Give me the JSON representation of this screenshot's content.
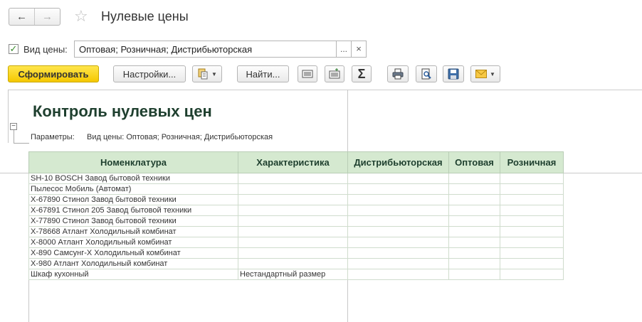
{
  "window": {
    "title": "Нулевые цены",
    "back_icon": "←",
    "forward_icon": "→",
    "star_icon": "☆"
  },
  "filter": {
    "checked_mark": "✓",
    "label": "Вид цены:",
    "value": "Оптовая; Розничная; Дистрибьюторская",
    "dots": "...",
    "clear": "×"
  },
  "toolbar": {
    "generate": "Сформировать",
    "settings": "Настройки...",
    "find": "Найти...",
    "sum_icon": "Σ",
    "caret": "▼"
  },
  "report": {
    "title": "Контроль нулевых цен",
    "params_label": "Параметры:",
    "params_value": "Вид цены: Оптовая; Розничная; Дистрибьюторская",
    "collapse": "−",
    "columns": [
      "Номенклатура",
      "Характеристика",
      "Дистрибьюторская",
      "Оптовая",
      "Розничная"
    ],
    "rows": [
      [
        "SH-10 BOSCH Завод бытовой техники",
        ""
      ],
      [
        "Пылесос Мобиль (Автомат)",
        ""
      ],
      [
        "X-67890 Стинол Завод бытовой техники",
        ""
      ],
      [
        "X-67891 Стинол 205 Завод бытовой техники",
        ""
      ],
      [
        "X-77890 Стинол Завод бытовой техники",
        ""
      ],
      [
        "X-78668 Атлант Холодильный комбинат",
        ""
      ],
      [
        "X-8000 Атлант Холодильный комбинат",
        ""
      ],
      [
        "X-890 Самсунг-Х Холодильный комбинат",
        ""
      ],
      [
        "X-980 Атлант Холодильный комбинат",
        ""
      ],
      [
        "Шкаф кухонный",
        "Нестандартный размер"
      ]
    ]
  },
  "colors": {
    "accent_yellow": "#f5c800",
    "header_green": "#d5e9d0",
    "title_green": "#1e3f2e"
  }
}
